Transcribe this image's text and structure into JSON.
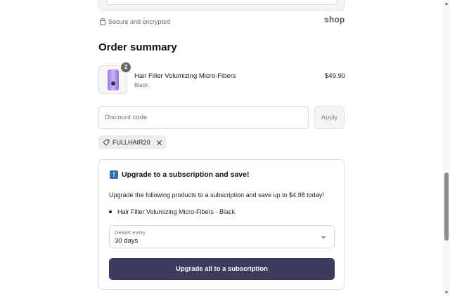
{
  "secure": {
    "text": "Secure and encrypted",
    "logo": "shop",
    "icon": "lock-icon"
  },
  "order_summary": {
    "title": "Order summary",
    "product": {
      "quantity": "2",
      "name": "Hair Filler Volumizing Micro-Fibers",
      "variant": "Black",
      "price": "$49.90"
    },
    "discount": {
      "placeholder": "Discount code",
      "value": "",
      "apply_label": "Apply",
      "applied_code": "FULLHAIR20"
    }
  },
  "upgrade": {
    "title": "Upgrade to a subscription and save!",
    "icon_glyph": "!",
    "description": "Upgrade the following products to a subscription and save up to $4.98 today!",
    "items": [
      "Hair Filler Volumizing Micro-Fibers - Black"
    ],
    "frequency": {
      "label": "Deliver every",
      "selected": "30 days"
    },
    "button_label": "Upgrade all to a subscription"
  },
  "colors": {
    "primary_button": "#3d3b5e",
    "badge": "#666666",
    "upgrade_icon": "#2f6fb5"
  }
}
